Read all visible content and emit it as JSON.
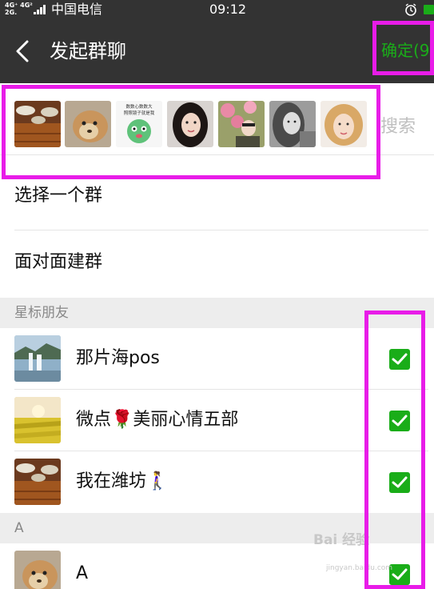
{
  "status_bar": {
    "network_top": "4G⁺ 4G²",
    "network_bottom": "2G.",
    "carrier": "中国电信",
    "time": "09:12",
    "alarm_icon": "alarm-clock-icon",
    "battery_icon": "battery-icon"
  },
  "header": {
    "back_icon": "chevron-left-icon",
    "title": "发起群聊",
    "confirm_label": "确定(9"
  },
  "selected_strip": {
    "avatars": [
      "table-photo",
      "dog-photo",
      "sticker-cartoon",
      "girl-portrait",
      "flowers-photo",
      "girl-bw-portrait",
      "girl-blonde-portrait"
    ],
    "sticker_text": "数数心数数大 照照镜子就是我",
    "search_label": "搜索"
  },
  "actions": [
    {
      "label": "选择一个群"
    },
    {
      "label": "面对面建群"
    }
  ],
  "sections": [
    {
      "header": "星标朋友",
      "contacts": [
        {
          "name": "那片海pos",
          "avatar": "waterfall-photo",
          "checked": true
        },
        {
          "name": "微点🌹美丽心情五部",
          "avatar": "rapeseed-field-photo",
          "checked": true
        },
        {
          "name": "我在潍坊🚶‍♀️",
          "avatar": "table-photo",
          "checked": true
        }
      ]
    },
    {
      "header": "A",
      "contacts": [
        {
          "name": "A",
          "avatar": "dog-photo",
          "checked": true
        }
      ]
    }
  ],
  "watermark": {
    "text": "Bai 经验",
    "url": "jingyan.baidu.com"
  },
  "colors": {
    "header_bg": "#333333",
    "accent_green": "#1aad19",
    "annotation": "#e81ce8",
    "section_bg": "#ededed"
  }
}
